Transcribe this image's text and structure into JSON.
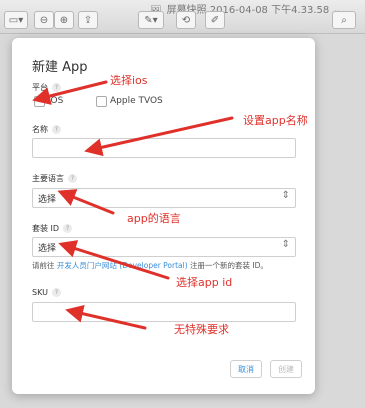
{
  "window": {
    "title": "屏幕快照 2016-04-08 下午4.33.58",
    "toolbar_icons": [
      "sidebar-icon",
      "zoom-out-icon",
      "zoom-in-icon",
      "share-icon",
      "pen-icon",
      "rotate-icon",
      "markup-icon",
      "search-icon"
    ]
  },
  "dialog": {
    "title": "新建 App",
    "platform": {
      "label": "平台",
      "help": "?",
      "options": [
        {
          "label": "iOS",
          "checked": false
        },
        {
          "label": "Apple TVOS",
          "checked": false
        }
      ]
    },
    "name": {
      "label": "名称",
      "help": "?",
      "value": "",
      "placeholder": ""
    },
    "primary_language": {
      "label": "主要语言",
      "help": "?",
      "selected": "选择"
    },
    "bundle_id": {
      "label": "套装 ID",
      "help": "?",
      "selected": "选择"
    },
    "hint": {
      "prefix": "请前往",
      "link": "开发人员门户网站 (Developer Portal)",
      "suffix": "注册一个新的套装 ID。"
    },
    "sku": {
      "label": "SKU",
      "help": "?",
      "value": "",
      "placeholder": ""
    },
    "buttons": {
      "cancel": "取消",
      "create": "创建"
    }
  },
  "annotations": {
    "select_ios": "选择ios",
    "set_app_name": "设置app名称",
    "app_language": "app的语言",
    "select_app_id": "选择app id",
    "no_special_requirement": "无特殊要求",
    "color": "#e0302a"
  }
}
